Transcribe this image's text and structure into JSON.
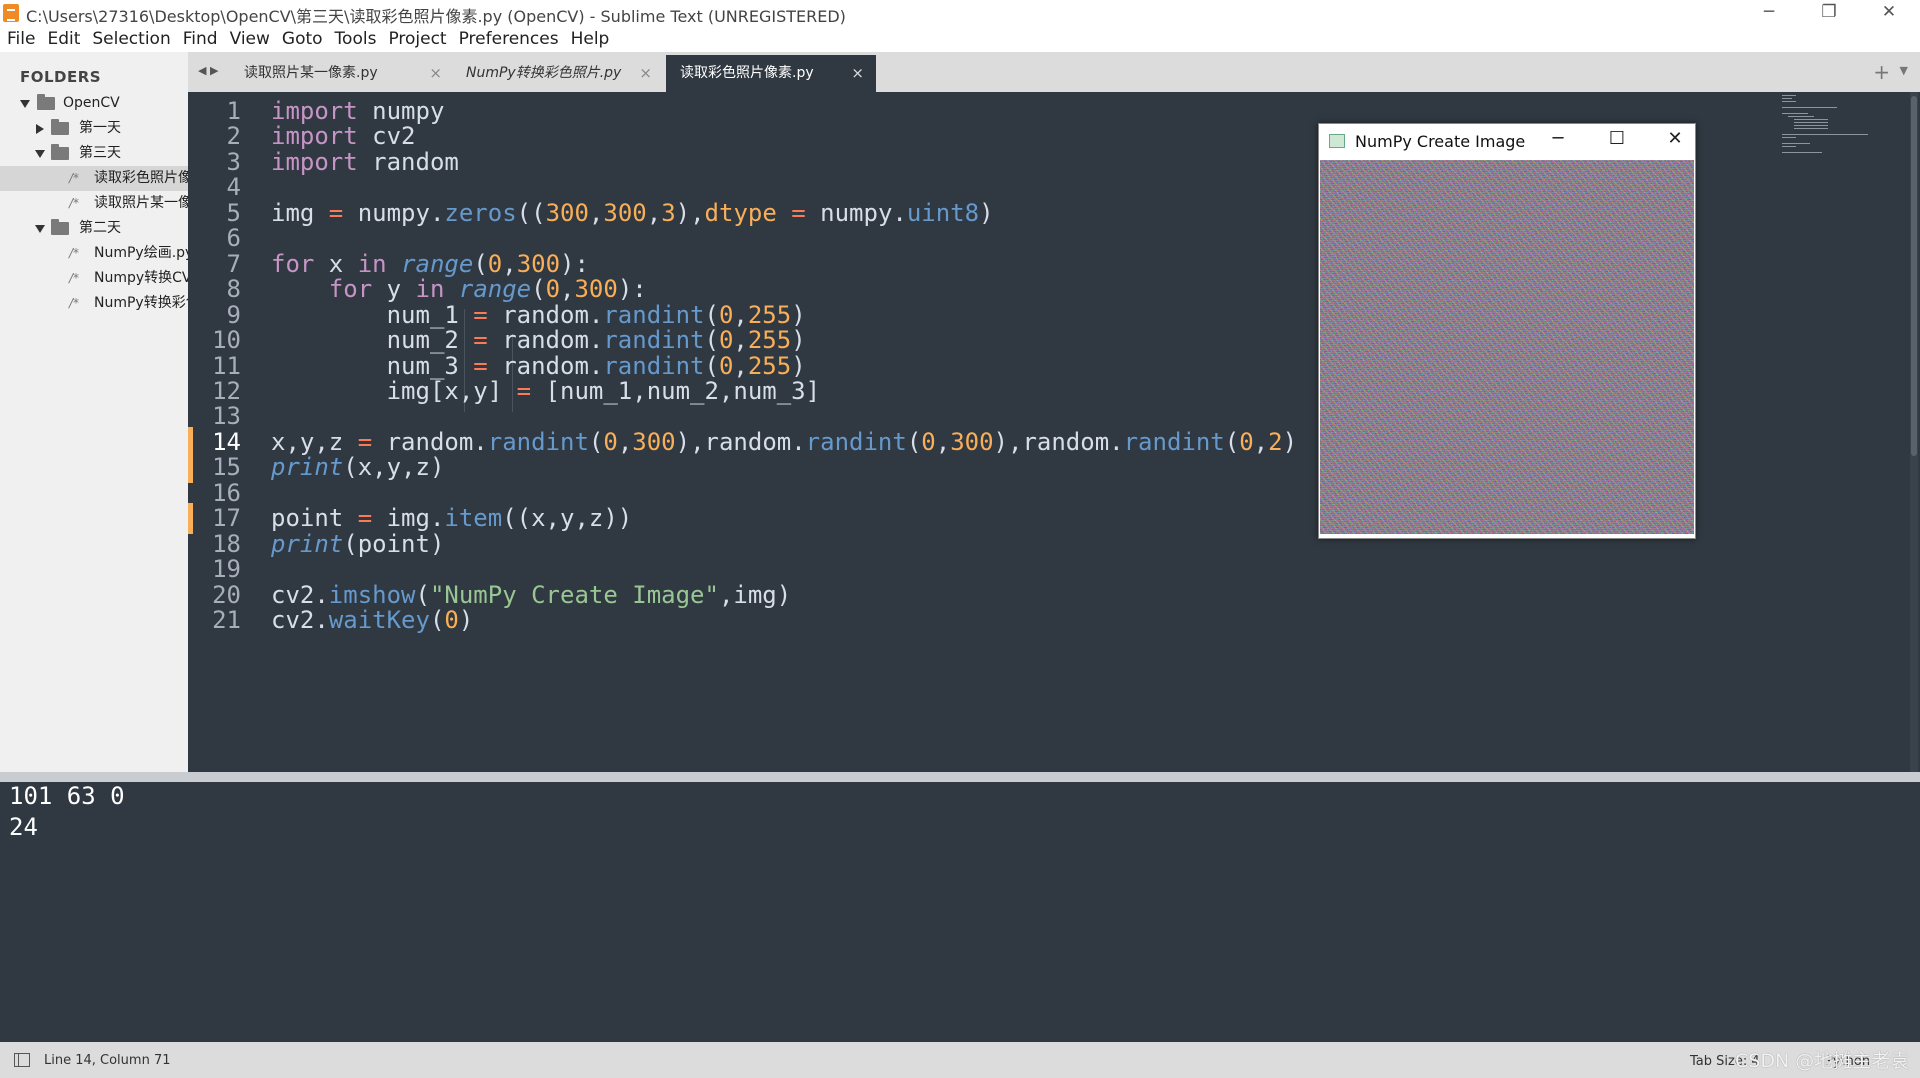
{
  "window": {
    "title": "C:\\Users\\27316\\Desktop\\OpenCV\\第三天\\读取彩色照片像素.py (OpenCV) - Sublime Text (UNREGISTERED)",
    "controls": [
      "─",
      "❐",
      "✕"
    ]
  },
  "menu": [
    "File",
    "Edit",
    "Selection",
    "Find",
    "View",
    "Goto",
    "Tools",
    "Project",
    "Preferences",
    "Help"
  ],
  "sidebar": {
    "header": "FOLDERS",
    "items": [
      {
        "label": "OpenCV",
        "kind": "folder",
        "expanded": true
      },
      {
        "label": "第一天",
        "kind": "folder",
        "expanded": false
      },
      {
        "label": "第三天",
        "kind": "folder",
        "expanded": true
      },
      {
        "label": "读取彩色照片像素.py",
        "kind": "file",
        "selected": true
      },
      {
        "label": "读取照片某一像素.py",
        "kind": "file"
      },
      {
        "label": "第二天",
        "kind": "folder",
        "expanded": true
      },
      {
        "label": "NumPy绘画.py",
        "kind": "file"
      },
      {
        "label": "Numpy转换CV.py",
        "kind": "file"
      },
      {
        "label": "NumPy转换彩色照片.py",
        "kind": "file"
      }
    ]
  },
  "tabs": [
    {
      "label": "读取照片某一像素.py",
      "active": false
    },
    {
      "label": "NumPy转换彩色照片.py",
      "active": false,
      "italic": true
    },
    {
      "label": "读取彩色照片像素.py",
      "active": true
    }
  ],
  "tab_nav": "◀ ▶",
  "tab_add": "+",
  "tab_menu": "▼",
  "close_glyph": "×",
  "editor": {
    "current_line": 14,
    "modified_lines": [
      14,
      15,
      17
    ],
    "lines": [
      {
        "n": "1",
        "code": "import numpy"
      },
      {
        "n": "2",
        "code": "import cv2"
      },
      {
        "n": "3",
        "code": "import random"
      },
      {
        "n": "4",
        "code": ""
      },
      {
        "n": "5",
        "code": "img = numpy.zeros((300,300,3),dtype = numpy.uint8)"
      },
      {
        "n": "6",
        "code": ""
      },
      {
        "n": "7",
        "code": "for x in range(0,300):"
      },
      {
        "n": "8",
        "code": "    for y in range(0,300):"
      },
      {
        "n": "9",
        "code": "        num_1 = random.randint(0,255)"
      },
      {
        "n": "10",
        "code": "        num_2 = random.randint(0,255)"
      },
      {
        "n": "11",
        "code": "        num_3 = random.randint(0,255)"
      },
      {
        "n": "12",
        "code": "        img[x,y] = [num_1,num_2,num_3]"
      },
      {
        "n": "13",
        "code": ""
      },
      {
        "n": "14",
        "code": "x,y,z = random.randint(0,300),random.randint(0,300),random.randint(0,2)"
      },
      {
        "n": "15",
        "code": "print(x,y,z)"
      },
      {
        "n": "16",
        "code": ""
      },
      {
        "n": "17",
        "code": "point = img.item((x,y,z))"
      },
      {
        "n": "18",
        "code": "print(point)"
      },
      {
        "n": "19",
        "code": ""
      },
      {
        "n": "20",
        "code": "cv2.imshow(\"NumPy Create Image\",img)"
      },
      {
        "n": "21",
        "code": "cv2.waitKey(0)"
      }
    ]
  },
  "popup": {
    "title": "NumPy Create Image",
    "controls": [
      "─",
      "☐",
      "✕"
    ]
  },
  "output": {
    "lines": [
      "101 63 0",
      "24"
    ]
  },
  "status": {
    "position": "Line 14, Column 71",
    "tab_size": "Tab Size: 4",
    "syntax": "Python",
    "watermark": "CSDN @地摊主老袁"
  },
  "colors": {
    "editor_bg": "#303841",
    "keyword": "#c695c6",
    "number": "#f9ae58",
    "function": "#6699cc",
    "operator": "#f97b58",
    "string": "#99c794"
  }
}
